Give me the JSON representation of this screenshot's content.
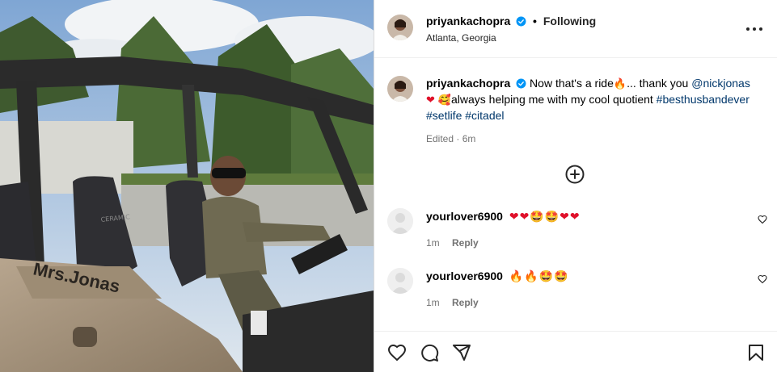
{
  "header": {
    "username": "priyankachopra",
    "separator": "•",
    "follow_status": "Following",
    "location": "Atlanta, Georgia"
  },
  "caption": {
    "username": "priyankachopra",
    "text_1": "Now that's a ride",
    "emoji_fire": "🔥",
    "text_2": "... thank you",
    "mention": "@nickjonas",
    "emoji_heart": "❤",
    "emoji_smile": "🥰",
    "text_3": "always helping me with my cool quotient",
    "hashtag_1": "#besthusbandever",
    "hashtag_2": "#setlife",
    "hashtag_3": "#citadel",
    "meta": "Edited · 6m"
  },
  "photo": {
    "vehicle_text": "Mrs.Jonas",
    "seat_text": "CERAMIC"
  },
  "comments": [
    {
      "username": "yourlover6900",
      "emojis": "❤❤🤩🤩❤❤",
      "time": "1m",
      "reply_label": "Reply"
    },
    {
      "username": "yourlover6900",
      "emojis": "🔥🔥🤩🤩",
      "time": "1m",
      "reply_label": "Reply"
    }
  ],
  "icons": {
    "more": "more-options-icon",
    "add_comment": "add-circle-icon",
    "like": "heart-icon",
    "comment": "comment-icon",
    "share": "share-icon",
    "save": "bookmark-icon"
  },
  "colors": {
    "verified": "#0095f6",
    "link": "#00376b",
    "heart_red": "#e0102a",
    "muted": "#737373"
  }
}
